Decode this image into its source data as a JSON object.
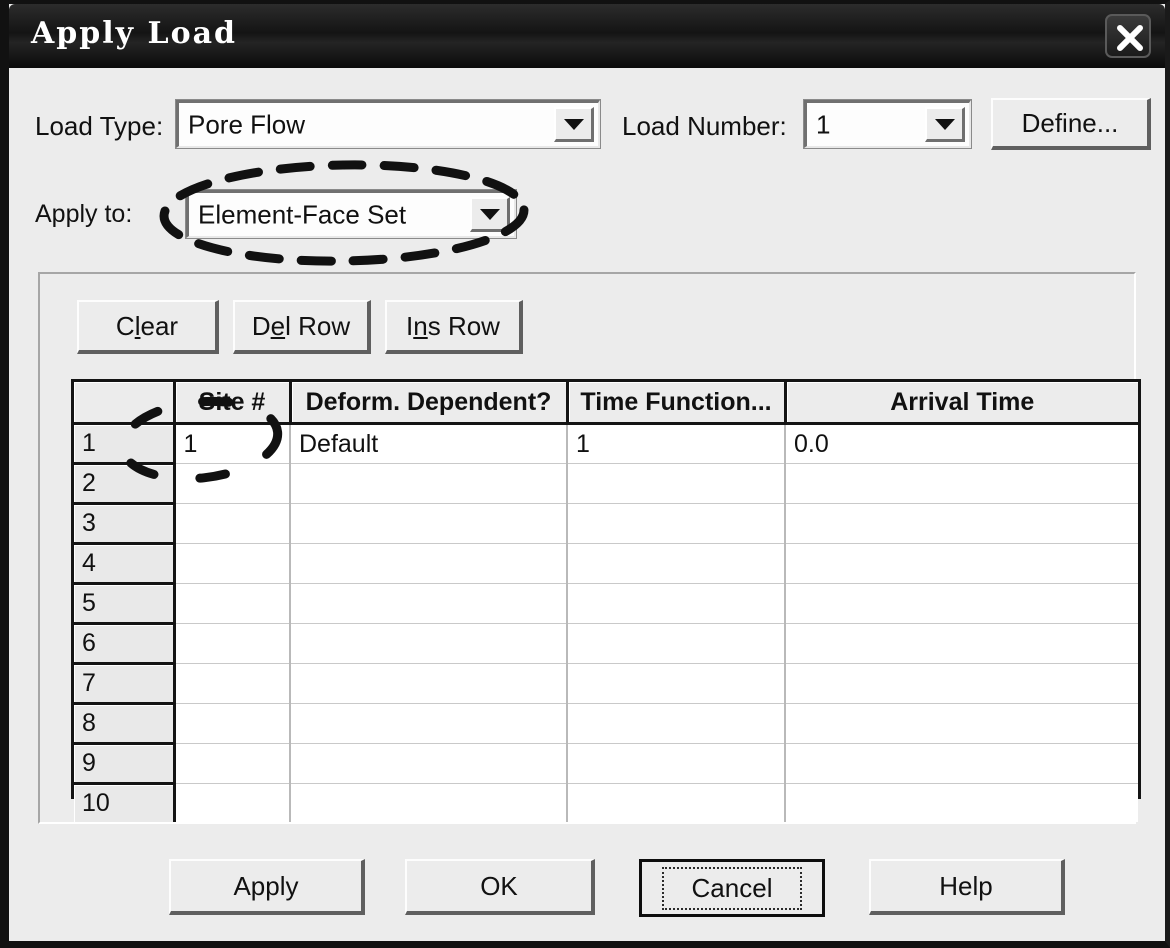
{
  "window": {
    "title": "Apply Load",
    "close_icon": "close-icon"
  },
  "form": {
    "load_type_label": "Load Type:",
    "load_type_value": "Pore Flow",
    "load_number_label": "Load Number:",
    "load_number_value": "1",
    "define_label": "Define...",
    "apply_to_label": "Apply to:",
    "apply_to_value": "Element-Face Set"
  },
  "grid_toolbar": {
    "clear": {
      "pre": "C",
      "accel": "l",
      "post": "ear"
    },
    "del_row": {
      "pre": "D",
      "accel": "e",
      "post": "l Row"
    },
    "ins_row": {
      "pre": "I",
      "accel": "n",
      "post": "s Row"
    }
  },
  "grid": {
    "columns": [
      "",
      "Site #",
      "Deform. Dependent?",
      "Time Function...",
      "Arrival Time"
    ],
    "rows": [
      {
        "num": "1",
        "site": "1",
        "deform": "Default",
        "timefn": "1",
        "arrival": "0.0"
      },
      {
        "num": "2",
        "site": "",
        "deform": "",
        "timefn": "",
        "arrival": ""
      },
      {
        "num": "3",
        "site": "",
        "deform": "",
        "timefn": "",
        "arrival": ""
      },
      {
        "num": "4",
        "site": "",
        "deform": "",
        "timefn": "",
        "arrival": ""
      },
      {
        "num": "5",
        "site": "",
        "deform": "",
        "timefn": "",
        "arrival": ""
      },
      {
        "num": "6",
        "site": "",
        "deform": "",
        "timefn": "",
        "arrival": ""
      },
      {
        "num": "7",
        "site": "",
        "deform": "",
        "timefn": "",
        "arrival": ""
      },
      {
        "num": "8",
        "site": "",
        "deform": "",
        "timefn": "",
        "arrival": ""
      },
      {
        "num": "9",
        "site": "",
        "deform": "",
        "timefn": "",
        "arrival": ""
      },
      {
        "num": "10",
        "site": "",
        "deform": "",
        "timefn": "",
        "arrival": ""
      }
    ]
  },
  "footer": {
    "apply": "Apply",
    "ok": "OK",
    "cancel": "Cancel",
    "help": "Help"
  },
  "annotations": {
    "apply_to_highlight": "dashed-ellipse",
    "site_cell_highlight": "dashed-ellipse"
  },
  "colors": {
    "dialog_bg": "#ececec",
    "titlebar_bg": "#141414",
    "titlebar_text": "#ffffff",
    "field_bg": "#fdfdfd",
    "grid_line": "#141414",
    "text": "#111111"
  }
}
